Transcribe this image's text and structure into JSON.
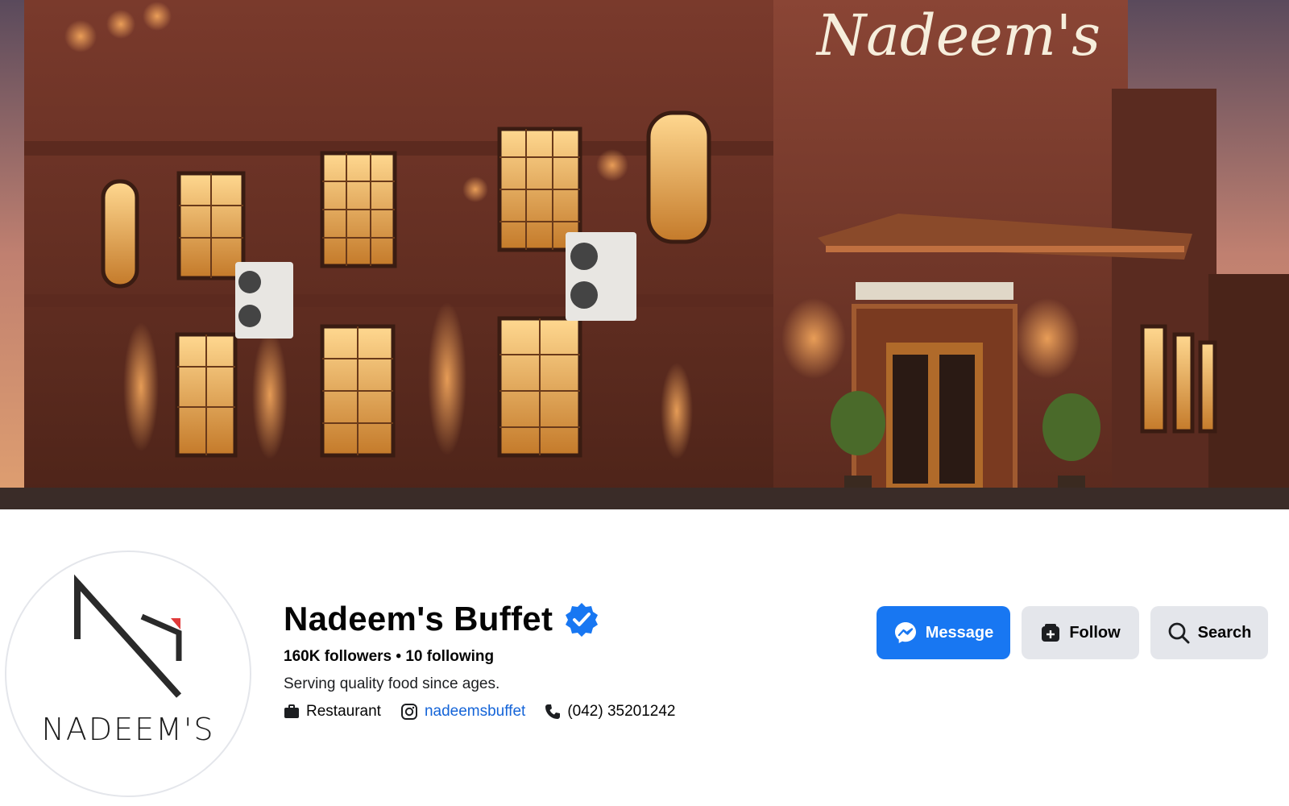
{
  "cover": {
    "sign_text": "Nadeem's"
  },
  "profile": {
    "avatar_text": "NADEEM'S",
    "page_name": "Nadeem's Buffet",
    "stats": "160K followers • 10 following",
    "bio": "Serving quality food since ages.",
    "category": "Restaurant",
    "instagram": "nadeemsbuffet",
    "phone": "(042) 35201242"
  },
  "actions": {
    "message_label": "Message",
    "follow_label": "Follow",
    "search_label": "Search"
  },
  "colors": {
    "primary": "#1877f2",
    "secondary": "#e4e6eb",
    "link": "#1464d8",
    "verified": "#1877f2"
  },
  "icons": {
    "verified": "verified-badge-icon",
    "category": "briefcase-icon",
    "instagram": "instagram-icon",
    "phone": "phone-icon",
    "message": "messenger-icon",
    "follow": "follow-icon",
    "search": "search-icon"
  }
}
